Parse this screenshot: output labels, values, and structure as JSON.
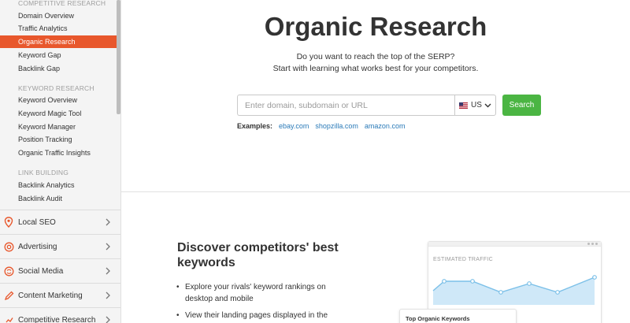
{
  "sidebar": {
    "sections": [
      {
        "title": "COMPETITIVE RESEARCH",
        "items": [
          {
            "label": "Domain Overview",
            "active": false
          },
          {
            "label": "Traffic Analytics",
            "active": false
          },
          {
            "label": "Organic Research",
            "active": true
          },
          {
            "label": "Keyword Gap",
            "active": false
          },
          {
            "label": "Backlink Gap",
            "active": false
          }
        ]
      },
      {
        "title": "KEYWORD RESEARCH",
        "items": [
          {
            "label": "Keyword Overview",
            "active": false
          },
          {
            "label": "Keyword Magic Tool",
            "active": false
          },
          {
            "label": "Keyword Manager",
            "active": false
          },
          {
            "label": "Position Tracking",
            "active": false
          },
          {
            "label": "Organic Traffic Insights",
            "active": false
          }
        ]
      },
      {
        "title": "LINK BUILDING",
        "items": [
          {
            "label": "Backlink Analytics",
            "active": false
          },
          {
            "label": "Backlink Audit",
            "active": false
          }
        ]
      }
    ],
    "groups": [
      {
        "label": "Local SEO",
        "icon": "location-pin-icon"
      },
      {
        "label": "Advertising",
        "icon": "target-icon"
      },
      {
        "label": "Social Media",
        "icon": "social-icon"
      },
      {
        "label": "Content Marketing",
        "icon": "pencil-icon"
      },
      {
        "label": "Competitive Research",
        "icon": "chart-icon"
      }
    ]
  },
  "main": {
    "title": "Organic Research",
    "subtitle_line1": "Do you want to reach the top of the SERP?",
    "subtitle_line2": "Start with learning what works best for your competitors.",
    "search": {
      "placeholder": "Enter domain, subdomain or URL",
      "country": "US",
      "button_label": "Search"
    },
    "examples": {
      "label": "Examples:",
      "links": [
        "ebay.com",
        "shopzilla.com",
        "amazon.com"
      ]
    },
    "discover": {
      "title_line1": "Discover competitors' best",
      "title_line2": "keywords",
      "bullet1_line1": "Explore your rivals' keyword rankings on",
      "bullet1_line2": "desktop and mobile",
      "bullet2_line1": "View their landing pages displayed in the"
    },
    "illustration": {
      "chart_label": "ESTIMATED TRAFFIC",
      "keywords_card_title": "Top Organic Keywords"
    }
  },
  "colors": {
    "accent": "#e8572c",
    "search_button": "#4bb543",
    "link": "#2a7ab8",
    "chart_line": "#7cc0e8"
  }
}
